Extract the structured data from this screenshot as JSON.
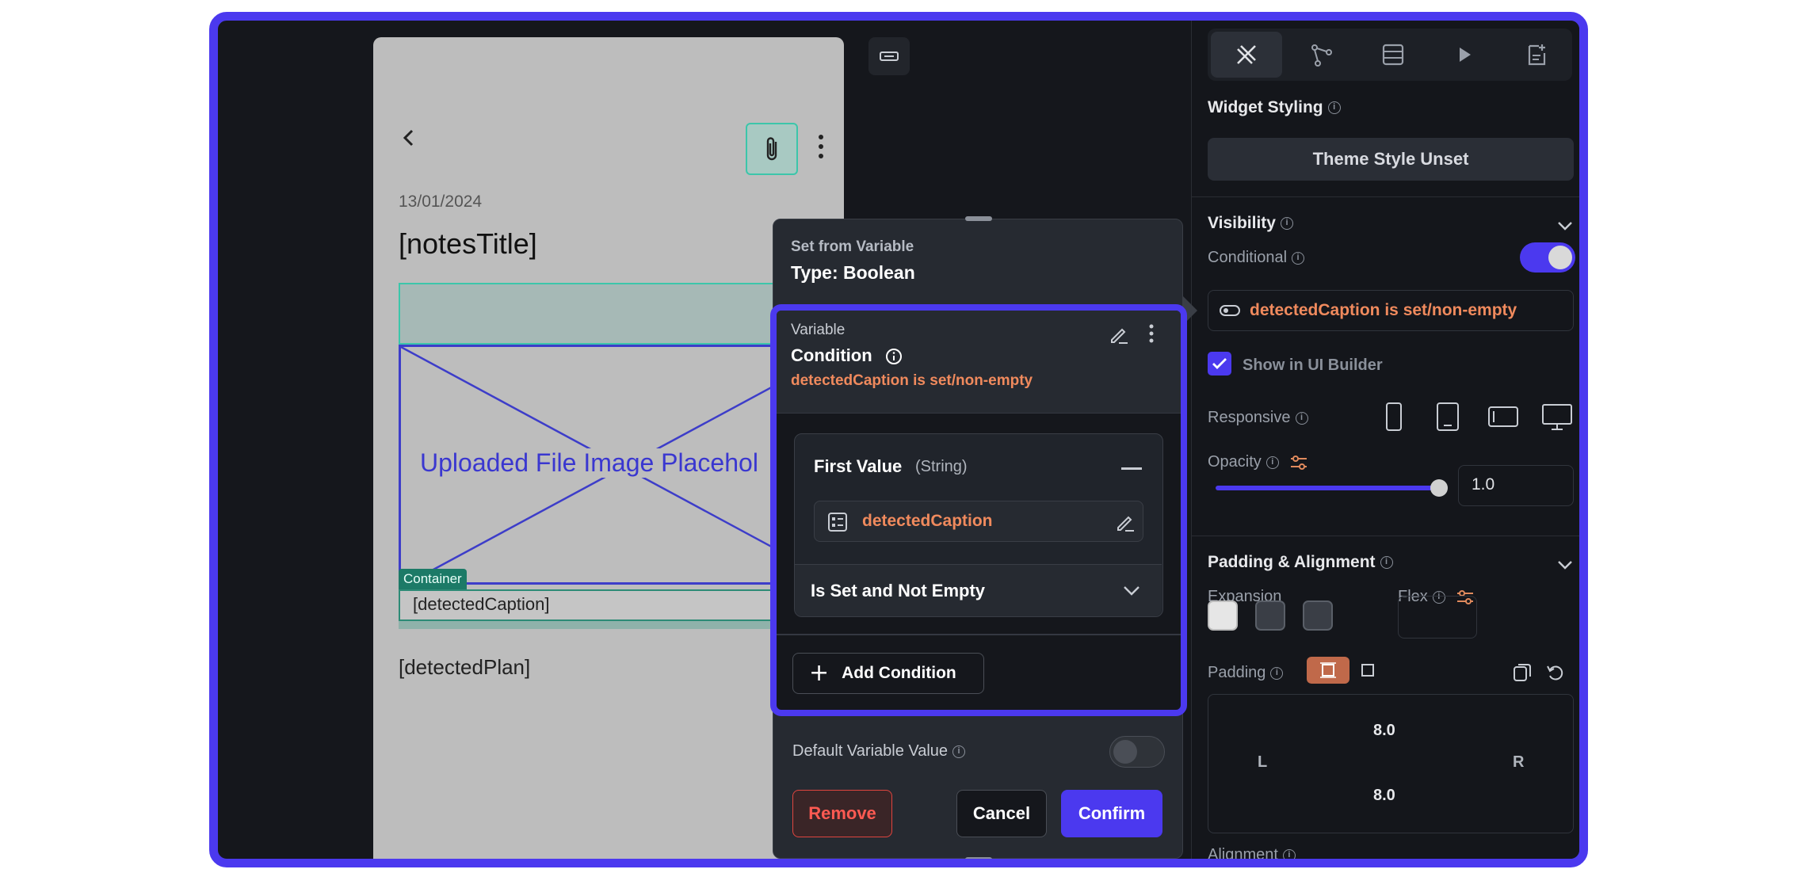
{
  "phone": {
    "date": "13/01/2024",
    "title": "[notesTitle]",
    "image_placeholder": "Uploaded File Image Placehol",
    "container_tag": "Container",
    "caption": "[detectedCaption]",
    "plan": "[detectedPlan]"
  },
  "sidebar": {
    "tabs": [
      "properties-icon",
      "actions-icon",
      "backend-query-icon",
      "run-icon",
      "add-document-icon"
    ],
    "widget_styling": "Widget Styling",
    "theme_style": "Theme Style Unset",
    "visibility": "Visibility",
    "conditional": "Conditional",
    "conditional_value": "detectedCaption is set/non-empty",
    "show_in_ui_builder": "Show in UI Builder",
    "responsive": "Responsive",
    "opacity": "Opacity",
    "opacity_value": "1.0",
    "padding_alignment": "Padding & Alignment",
    "expansion": "Expansion",
    "flex": "Flex",
    "padding": "Padding",
    "pad_top": "8.0",
    "pad_bottom": "8.0",
    "pad_left": "L",
    "pad_right": "R",
    "alignment": "Alignment"
  },
  "popup": {
    "set_from": "Set from Variable",
    "type": "Type: Boolean",
    "condition": {
      "variable_label": "Variable",
      "title": "Condition",
      "description": "detectedCaption is set/non-empty",
      "first_value_label": "First Value",
      "first_value_type": "(String)",
      "first_value": "detectedCaption",
      "operator": "Is Set and Not Empty",
      "add_condition": "Add Condition"
    },
    "default_label": "Default Variable Value",
    "remove": "Remove",
    "cancel": "Cancel",
    "confirm": "Confirm"
  },
  "colors": {
    "accent": "#4b39ef",
    "orange_text": "#f08a5d",
    "panel_bg": "#15171c",
    "danger": "#ff5a52"
  }
}
